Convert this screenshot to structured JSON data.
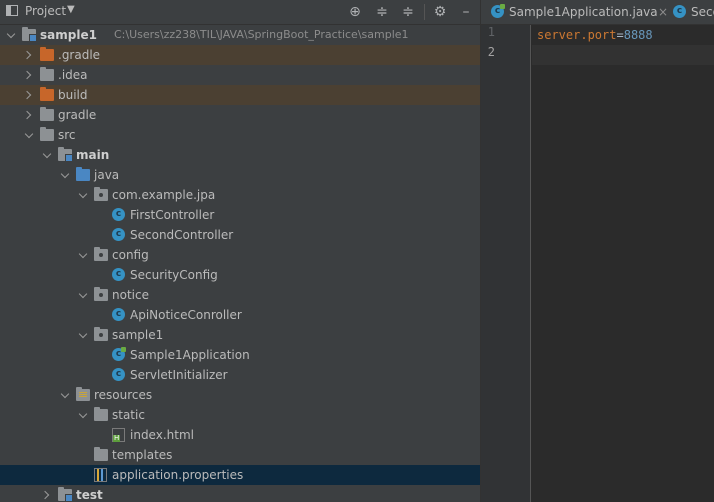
{
  "project_panel": {
    "title": "Project",
    "tools": [
      "locate-icon",
      "expand-all-icon",
      "collapse-all-icon",
      "gear-icon",
      "hide-icon"
    ]
  },
  "tree": [
    {
      "name": "sample1",
      "path": "C:\\Users\\zz238\\TIL\\JAVA\\SpringBoot_Practice\\sample1",
      "level": 0,
      "arrow": "down",
      "icon": "module-folder-icon",
      "bold": true
    },
    {
      "name": ".gradle",
      "level": 1,
      "arrow": "right",
      "icon": "folder-excluded-icon",
      "highlight": "excluded"
    },
    {
      "name": ".idea",
      "level": 1,
      "arrow": "right",
      "icon": "folder-icon"
    },
    {
      "name": "build",
      "level": 1,
      "arrow": "right",
      "icon": "folder-excluded-icon",
      "highlight": "excluded"
    },
    {
      "name": "gradle",
      "level": 1,
      "arrow": "right",
      "icon": "folder-icon"
    },
    {
      "name": "src",
      "level": 1,
      "arrow": "down",
      "icon": "folder-icon"
    },
    {
      "name": "main",
      "level": 2,
      "arrow": "down",
      "icon": "module-folder-icon",
      "bold": true
    },
    {
      "name": "java",
      "level": 3,
      "arrow": "down",
      "icon": "source-folder-icon"
    },
    {
      "name": "com.example.jpa",
      "level": 4,
      "arrow": "down",
      "icon": "package-icon"
    },
    {
      "name": "FirstController",
      "level": 5,
      "icon": "class-icon"
    },
    {
      "name": "SecondController",
      "level": 5,
      "icon": "class-icon"
    },
    {
      "name": "config",
      "level": 4,
      "arrow": "down",
      "icon": "package-icon"
    },
    {
      "name": "SecurityConfig",
      "level": 5,
      "icon": "class-icon"
    },
    {
      "name": "notice",
      "level": 4,
      "arrow": "down",
      "icon": "package-icon"
    },
    {
      "name": "ApiNoticeConroller",
      "level": 5,
      "icon": "class-icon"
    },
    {
      "name": "sample1",
      "level": 4,
      "arrow": "down",
      "icon": "package-icon"
    },
    {
      "name": "Sample1Application",
      "level": 5,
      "icon": "spring-boot-class-icon"
    },
    {
      "name": "ServletInitializer",
      "level": 5,
      "icon": "class-icon"
    },
    {
      "name": "resources",
      "level": 3,
      "arrow": "down",
      "icon": "resources-folder-icon"
    },
    {
      "name": "static",
      "level": 4,
      "arrow": "down",
      "icon": "folder-icon"
    },
    {
      "name": "index.html",
      "level": 5,
      "icon": "html-file-icon"
    },
    {
      "name": "templates",
      "level": 4,
      "icon": "folder-icon"
    },
    {
      "name": "application.properties",
      "level": 4,
      "icon": "properties-file-icon",
      "selected": true
    },
    {
      "name": "test",
      "level": 2,
      "arrow": "right",
      "icon": "module-folder-icon",
      "bold": true
    }
  ],
  "editor": {
    "tabs": [
      {
        "label": "Sample1Application.java",
        "icon": "spring-boot-class-icon",
        "close": "×"
      },
      {
        "label": "Seco",
        "icon": "class-icon"
      }
    ],
    "line_numbers": [
      "1",
      "2"
    ],
    "code": {
      "key": "server.port",
      "eq": "=",
      "value": "8888"
    }
  },
  "colors": {
    "selection": "#0d293e",
    "excluded": "#4b4032",
    "accent": "#3592c4"
  }
}
